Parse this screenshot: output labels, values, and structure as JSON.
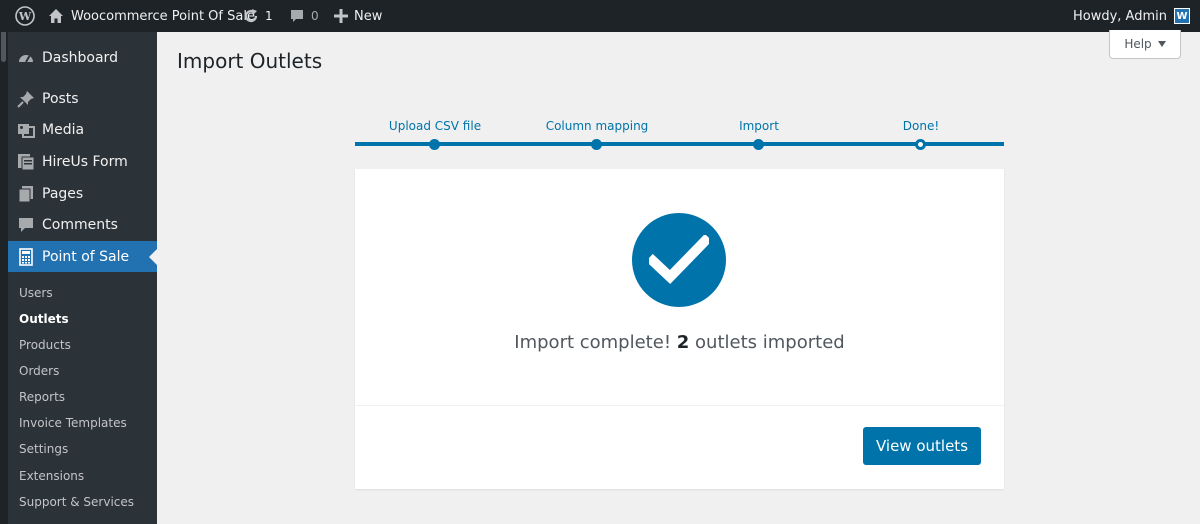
{
  "adminbar": {
    "site_name": "Woocommerce Point Of Sale",
    "updates_count": "1",
    "comments_count": "0",
    "new_label": "New",
    "howdy": "Howdy, Admin"
  },
  "sidebar": {
    "items": [
      {
        "label": "Dashboard",
        "icon": "dashboard-icon"
      },
      {
        "label": "Posts",
        "icon": "pin-icon"
      },
      {
        "label": "Media",
        "icon": "media-icon"
      },
      {
        "label": "HireUs Form",
        "icon": "form-icon"
      },
      {
        "label": "Pages",
        "icon": "pages-icon"
      },
      {
        "label": "Comments",
        "icon": "comment-icon"
      },
      {
        "label": "Point of Sale",
        "icon": "calculator-icon"
      }
    ],
    "submenu": [
      "Users",
      "Outlets",
      "Products",
      "Orders",
      "Reports",
      "Invoice Templates",
      "Settings",
      "Extensions",
      "Support & Services"
    ]
  },
  "page": {
    "title": "Import Outlets",
    "help_label": "Help"
  },
  "steps": [
    "Upload CSV file",
    "Column mapping",
    "Import",
    "Done!"
  ],
  "result": {
    "prefix": "Import complete!",
    "count": "2",
    "suffix": "outlets imported"
  },
  "view_button": "View outlets",
  "colors": {
    "accent": "#0073aa",
    "adminbar": "#1d2327",
    "sidebar": "#2c3338",
    "active_menu": "#2271b1"
  }
}
